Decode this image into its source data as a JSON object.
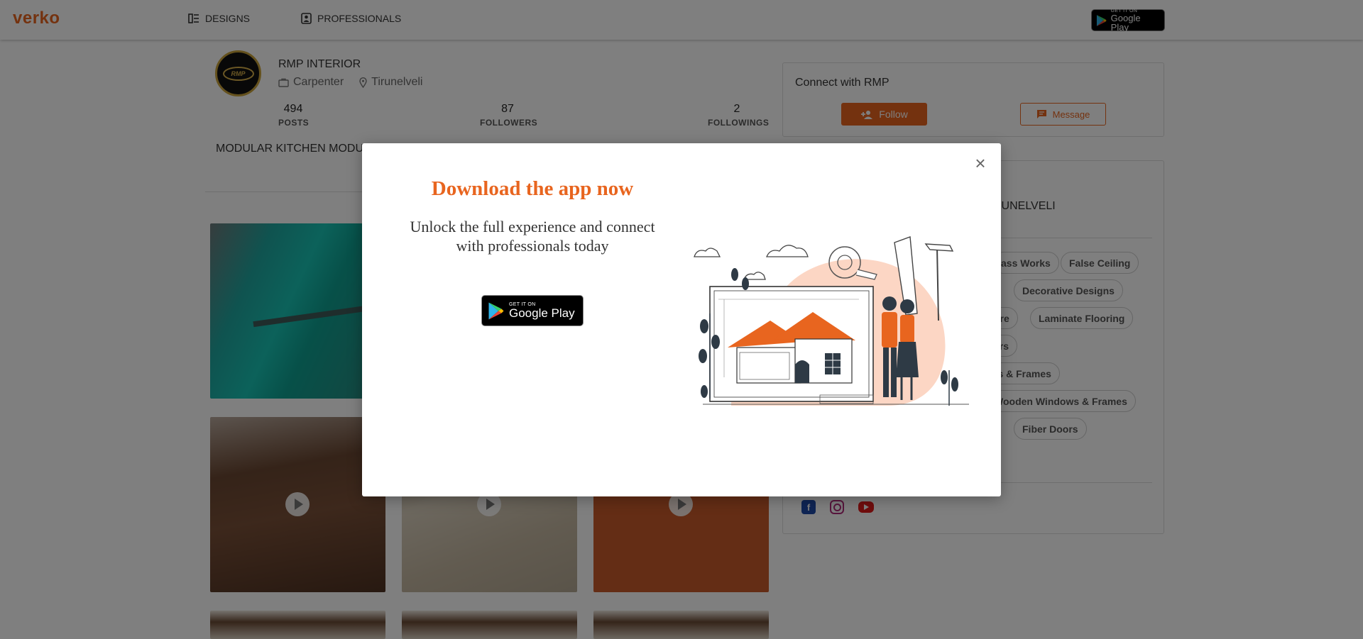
{
  "header": {
    "logo": "verko",
    "nav": [
      {
        "label": "DESIGNS",
        "icon": "designs-icon"
      },
      {
        "label": "PROFESSIONALS",
        "icon": "professionals-icon"
      }
    ],
    "store_badge": {
      "small": "GET IT ON",
      "big": "Google Play"
    }
  },
  "profile": {
    "avatar_text": "RMP",
    "name": "RMP INTERIOR",
    "profession": "Carpenter",
    "location": "Tirunelveli",
    "stats": [
      {
        "value": "494",
        "label": "POSTS"
      },
      {
        "value": "87",
        "label": "FOLLOWERS"
      },
      {
        "value": "2",
        "label": "FOLLOWINGS"
      }
    ],
    "category_tab": "MODULAR KITCHEN MODU"
  },
  "connect": {
    "title": "Connect with RMP",
    "follow_label": "Follow",
    "message_label": "Message"
  },
  "about": {
    "title_visible": "RUNELVELI",
    "chips": [
      "ass Works",
      "False Ceiling",
      "Decorative Designs",
      "ure",
      "Laminate Flooring",
      "ers",
      "rs & Frames",
      "Wooden Windows & Frames",
      "Fiber Doors"
    ],
    "social": [
      "facebook-icon",
      "instagram-icon",
      "youtube-icon"
    ]
  },
  "modal": {
    "title": "Download the app now",
    "subtitle": "Unlock the full experience and connect with professionals today",
    "badge": {
      "small": "GET IT ON",
      "big": "Google Play"
    },
    "close": "×"
  },
  "colors": {
    "accent": "#e8651f",
    "overlay": "rgba(0,0,0,0.5)"
  }
}
